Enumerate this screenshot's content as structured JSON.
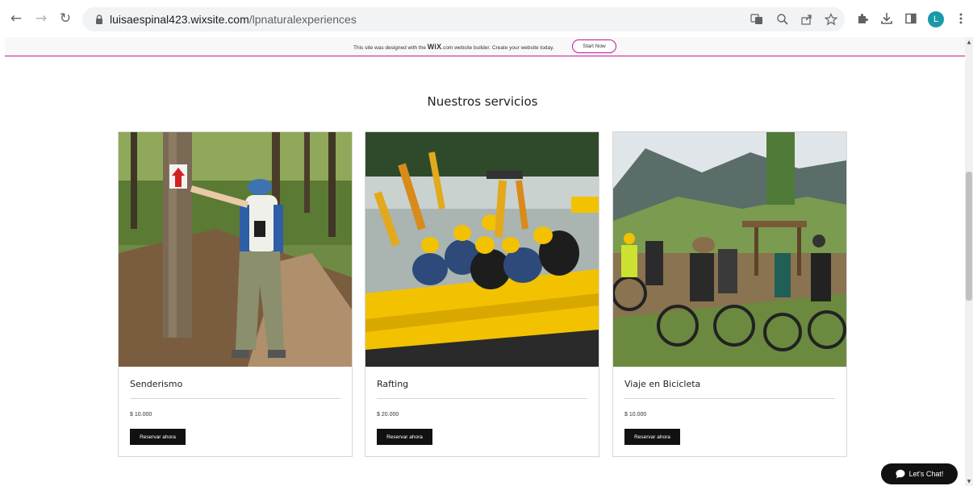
{
  "browser": {
    "url_host": "luisaespinal423.wixsite.com",
    "url_path": "/lpnaturalexperiences",
    "avatar_letter": "L"
  },
  "wix_banner": {
    "text_before": "This site was designed with the ",
    "brand": "WiX",
    "text_after": ".com website builder. Create your website today.",
    "button": "Start Now"
  },
  "section": {
    "title": "Nuestros servicios"
  },
  "services": [
    {
      "name": "Senderismo",
      "price": "$ 10.000",
      "button": "Reservar ahora"
    },
    {
      "name": "Rafting",
      "price": "$ 20.000",
      "button": "Reservar ahora"
    },
    {
      "name": "Viaje en Bicicleta",
      "price": "$ 10.000",
      "button": "Reservar ahora"
    }
  ],
  "chat": {
    "label": "Let's Chat!"
  },
  "colors": {
    "wix_accent": "#c2188e",
    "button_bg": "#111111",
    "avatar": "#1a9aa8"
  }
}
